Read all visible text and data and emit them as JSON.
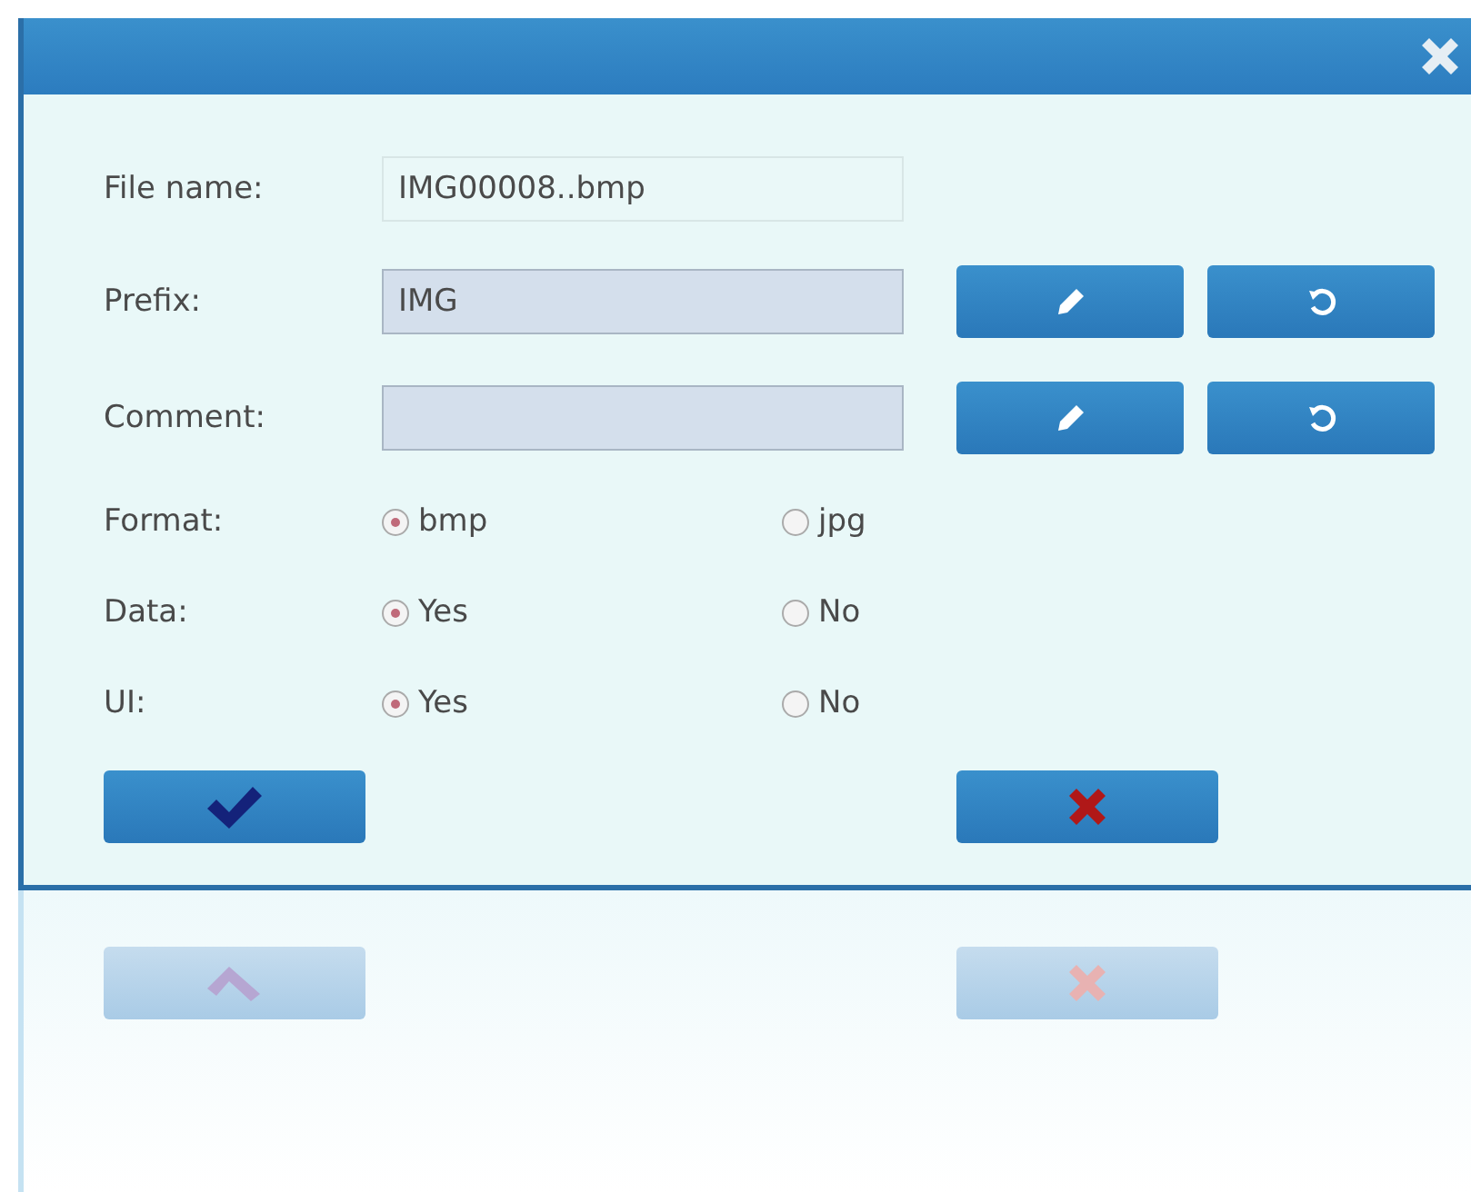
{
  "fields": [
    {
      "label": "File name:",
      "value": "IMG00008..bmp",
      "kind": "readonly"
    },
    {
      "label": "Prefix:",
      "value": "IMG",
      "kind": "editable"
    },
    {
      "label": "Comment:",
      "kind": "editable"
    }
  ],
  "options": [
    {
      "label": "Format:",
      "choices": [
        {
          "label": "bmp",
          "selected": true
        },
        {
          "label": "jpg",
          "selected": false
        }
      ]
    },
    {
      "label": "Data:",
      "choices": [
        {
          "label": "Yes",
          "selected": true
        },
        {
          "label": "No",
          "selected": false
        }
      ]
    },
    {
      "label": "UI:",
      "choices": [
        {
          "label": "Yes",
          "selected": true
        },
        {
          "label": "No",
          "selected": false
        }
      ]
    }
  ]
}
